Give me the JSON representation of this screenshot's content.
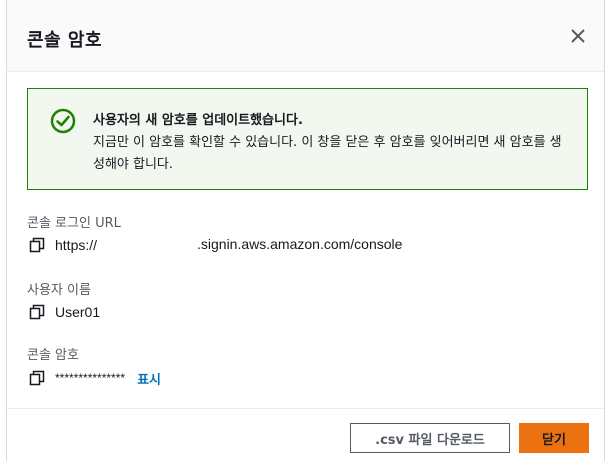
{
  "modal": {
    "title": "콘솔 암호"
  },
  "alert": {
    "title": "사용자의 새 암호를 업데이트했습니다.",
    "body": "지금만 이 암호를 확인할 수 있습니다. 이 창을 닫은 후 암호를 잊어버리면 새 암호를 생성해야 합니다.",
    "status_color": "#1d8102"
  },
  "fields": {
    "console_url": {
      "label": "콘솔 로그인 URL",
      "scheme": "https://",
      "host_suffix": ".signin.aws.amazon.com/console"
    },
    "username": {
      "label": "사용자 이름",
      "value": "User01"
    },
    "password": {
      "label": "콘솔 암호",
      "value": "***************",
      "show_link": "표시"
    }
  },
  "footer": {
    "download_label": ".csv 파일 다운로드",
    "close_label": "닫기",
    "primary_color": "#ec7211"
  },
  "icons": [
    "close-icon",
    "success-check-icon",
    "copy-icon"
  ]
}
